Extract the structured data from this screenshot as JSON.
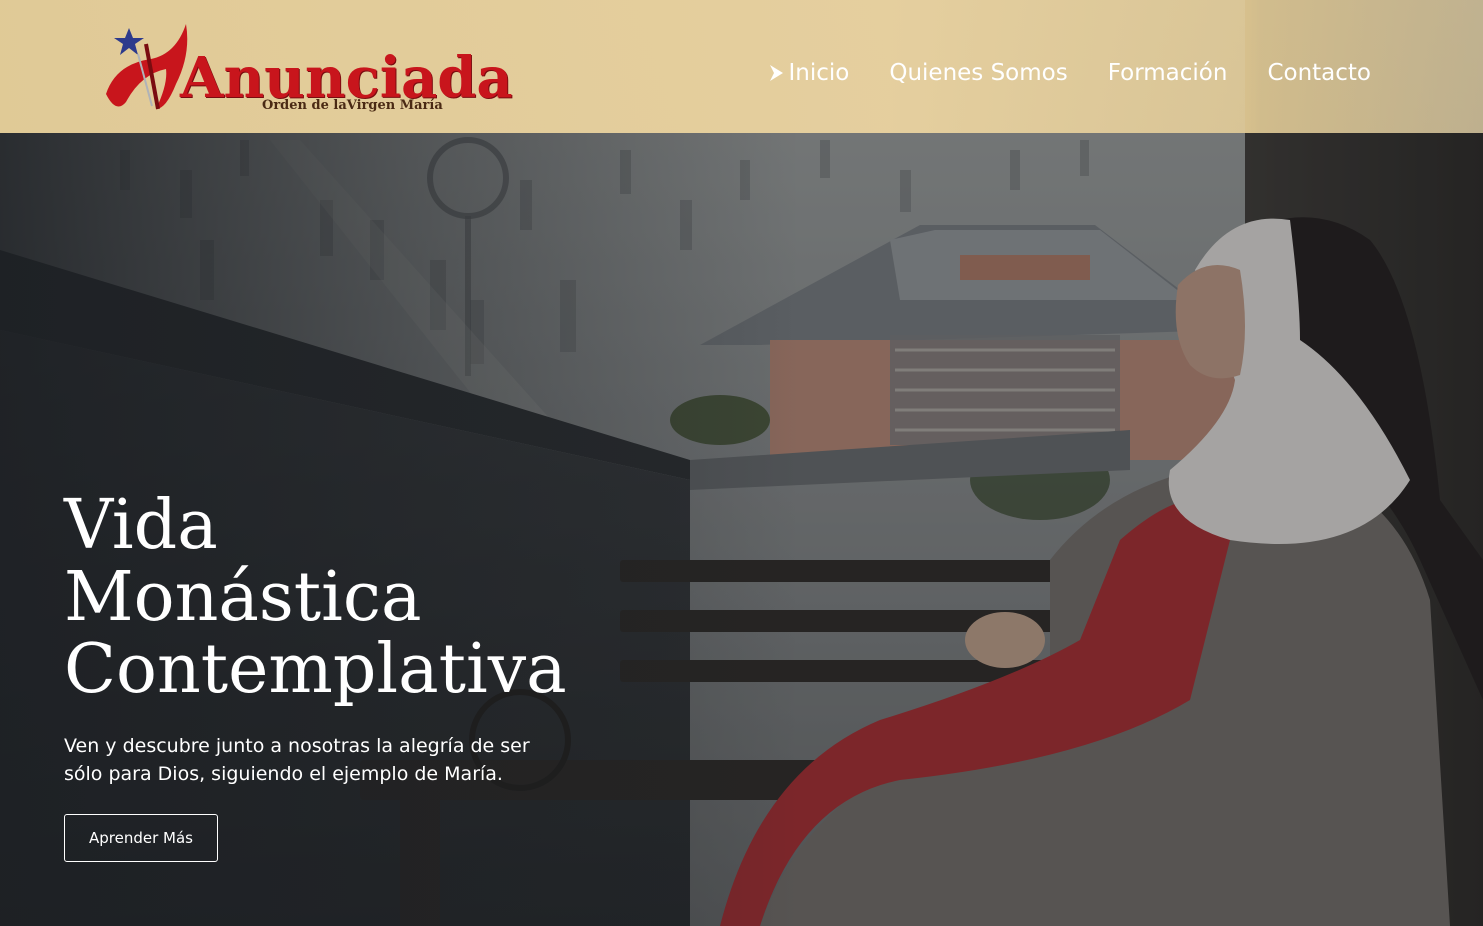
{
  "header": {
    "logo": {
      "name": "Anunciada",
      "tagline": "Orden de laVirgen María"
    },
    "nav": [
      {
        "label": "Inicio",
        "active": true,
        "icon": "chevron-right-icon"
      },
      {
        "label": "Quienes Somos",
        "active": false
      },
      {
        "label": "Formación",
        "active": false
      },
      {
        "label": "Contacto",
        "active": false
      }
    ]
  },
  "hero": {
    "title_lines": [
      "Vida",
      "Monástica",
      "Contemplativa"
    ],
    "subtitle": "Ven y descubre junto a nosotras la alegría de ser sólo para Dios, siguiendo el ejemplo de María.",
    "button_label": "Aprender Más"
  },
  "colors": {
    "header_bg": "#e6cf9c",
    "logo_red": "#c8151c",
    "logo_star": "#2d3a8c",
    "text_white": "#ffffff",
    "habit_red": "#b02a2e"
  }
}
